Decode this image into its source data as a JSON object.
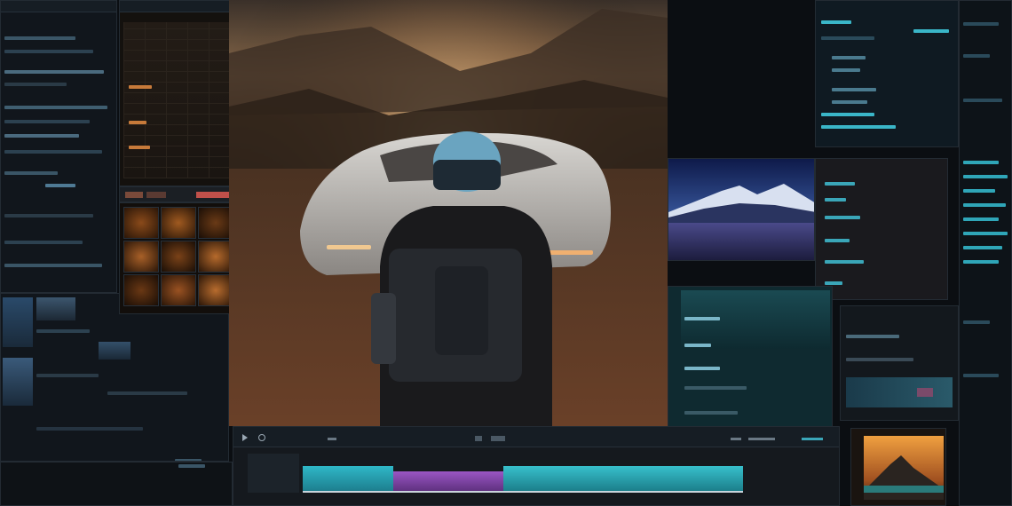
{
  "colors": {
    "background": "#0b0e12",
    "panel": "#11161c",
    "accent_cyan": "#2fb3c6",
    "accent_purple": "#8a4fc4",
    "amber": "#e07a2f"
  },
  "icons": [
    "play-icon",
    "scissors-icon",
    "zoom-icon",
    "snap-icon"
  ],
  "preview": {
    "description_hidden": true
  },
  "timeline": {
    "tracks": 1
  }
}
